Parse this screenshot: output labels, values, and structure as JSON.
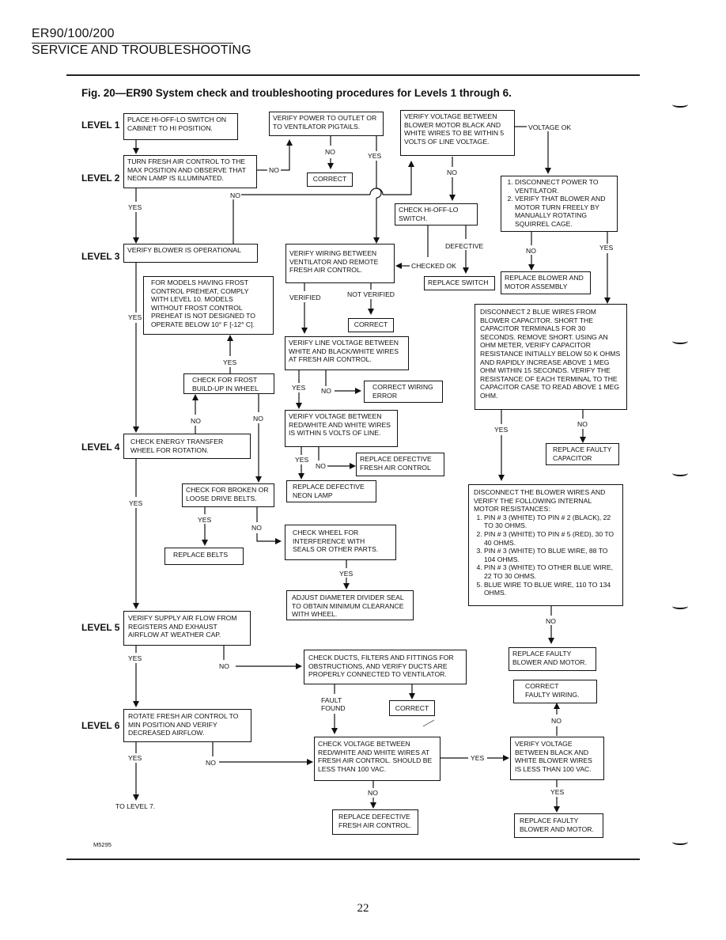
{
  "header": {
    "model": "ER90/100/200",
    "section": "SERVICE AND TROUBLESHOOTING"
  },
  "figure": {
    "title": "Fig. 20—ER90 System check and troubleshooting procedures for Levels 1 through 6.",
    "code": "M5295"
  },
  "levels": [
    "LEVEL 1",
    "LEVEL 2",
    "LEVEL 3",
    "LEVEL 4",
    "LEVEL 5",
    "LEVEL 6"
  ],
  "boxes": {
    "place_switch": "PLACE HI-OFF-LO SWITCH ON CABINET TO HI POSITION.",
    "turn_fresh_air": "TURN FRESH AIR CONTROL TO THE MAX POSITION AND OBSERVE THAT NEON LAMP IS ILLUMINATED.",
    "verify_power": "VERIFY POWER TO OUTLET OR TO VENTILATOR  PIGTAILS.",
    "correct_1": "CORRECT",
    "verify_voltage_blower": "VERIFY VOLTAGE BETWEEN BLOWER MOTOR BLACK AND WHITE WIRES TO BE WITHIN 5 VOLTS OF LINE VOLTAGE.",
    "disconnect_power": [
      "DISCONNECT POWER TO VENTILATOR.",
      "VERIFY THAT BLOWER AND MOTOR TURN FREELY BY MANUALLY ROTATING SQUIRREL CAGE."
    ],
    "check_switch": "CHECK HI-OFF-LO SWITCH.",
    "verify_blower": "VERIFY BLOWER IS OPERATIONAL",
    "verify_wiring": "VERIFY WIRING BETWEEN VENTILATOR AND REMOTE FRESH AIR CONTROL.",
    "replace_switch": "REPLACE SWITCH",
    "replace_blower_assembly": "REPLACE BLOWER AND MOTOR ASSEMBLY",
    "frost_note": "FOR MODELS HAVING FROST CONTROL PREHEAT,  COMPLY WITH LEVEL 10.  MODELS WITHOUT FROST CONTROL PREHEAT IS NOT DESIGNED TO OPERATE BELOW 10° F [-12° C].",
    "correct_2": "CORRECT",
    "disconnect_capacitor": "DISCONNECT 2 BLUE WIRES FROM BLOWER CAPACITOR.  SHORT THE CAPACITOR TERMINALS FOR 30 SECONDS.  REMOVE SHORT.  USING AN OHM METER, VERIFY CAPACITOR RESISTANCE INITIALLY BELOW 50 K OHMS AND RAPIDLY INCREASE ABOVE 1 MEG OHM WITHIN 15 SECONDS.  VERIFY THE RESISTANCE OF EACH TERMINAL TO THE CAPACITOR CASE TO READ ABOVE 1 MEG OHM.",
    "verify_line_voltage": "VERIFY LINE VOLTAGE BETWEEN WHITE AND BLACK/WHITE WIRES AT FRESH AIR CONTROL.",
    "check_frost": "CHECK FOR FROST BUILD-UP IN WHEEL",
    "correct_wiring_error": "CORRECT WIRING ERROR",
    "verify_redwhite": "VERIFY VOLTAGE BETWEEN RED/WHITE AND WHITE WIRES IS WITHIN 5 VOLTS OF LINE.",
    "check_wheel_rotation": "CHECK ENERGY TRANSFER WHEEL FOR ROTATION.",
    "replace_fac_1": "REPLACE DEFECTIVE FRESH AIR CONTROL",
    "replace_capacitor": "REPLACE FAULTY CAPACITOR",
    "replace_neon": "REPLACE DEFECTIVE NEON LAMP",
    "check_belts": "CHECK FOR BROKEN OR LOOSE DRIVE BELTS.",
    "motor_resistances_intro": "DISCONNECT THE BLOWER WIRES AND VERIFY THE FOLLOWING INTERNAL MOTOR RESISTANCES:",
    "motor_resistances": [
      "PIN # 3 (WHITE) TO PIN # 2 (BLACK), 22 TO 30 OHMS.",
      "PIN # 3 (WHITE) TO PIN # 5 (RED), 30 TO 40 OHMS.",
      "PIN # 3 (WHITE) TO BLUE WIRE,  88 TO 104 OHMS.",
      "PIN # 3 (WHITE) TO OTHER BLUE WIRE, 22 TO 30 OHMS.",
      "BLUE WIRE TO BLUE WIRE, 110 TO 134  OHMS."
    ],
    "check_interference": "CHECK WHEEL FOR INTERFERENCE WITH SEALS OR OTHER PARTS.",
    "replace_belts": "REPLACE BELTS",
    "adjust_seal": "ADJUST  DIAMETER DIVIDER SEAL TO OBTAIN MINIMUM CLEARANCE WITH WHEEL.",
    "verify_supply_air": "VERIFY SUPPLY AIR FLOW FROM REGISTERS AND EXHAUST AIRFLOW AT WEATHER CAP.",
    "check_ducts": "CHECK DUCTS, FILTERS AND FITTINGS FOR OBSTRUCTIONS, AND VERIFY DUCTS ARE PROPERLY CONNECTED TO VENTILATOR.",
    "replace_blower_1": "REPLACE FAULTY BLOWER AND MOTOR.",
    "correct_faulty_wiring": "CORRECT FAULTY WIRING.",
    "correct_3": "CORRECT",
    "rotate_min": "ROTATE FRESH AIR CONTROL TO MIN POSITION AND VERIFY DECREASED AIRFLOW.",
    "check_voltage_100": "CHECK VOLTAGE BETWEEN RED/WHITE AND WHITE WIRES AT FRESH AIR CONTROL.  SHOULD BE LESS THAN 100 VAC.",
    "verify_black_white_100": "VERIFY VOLTAGE BETWEEN BLACK AND WHITE BLOWER WIRES IS LESS THAN 100 VAC.",
    "replace_fac_2": "REPLACE DEFECTIVE FRESH AIR CONTROL.",
    "replace_blower_2": "REPLACE FAULTY BLOWER AND MOTOR.",
    "to_level_7": "TO LEVEL 7."
  },
  "labels": {
    "yes": "YES",
    "no": "NO",
    "voltage_ok": "VOLTAGE OK",
    "defective": "DEFECTIVE",
    "checked_ok": "CHECKED OK",
    "verified": "VERIFIED",
    "not_verified": "NOT VERIFIED",
    "fault_found": "FAULT FOUND"
  },
  "page_number": "22"
}
